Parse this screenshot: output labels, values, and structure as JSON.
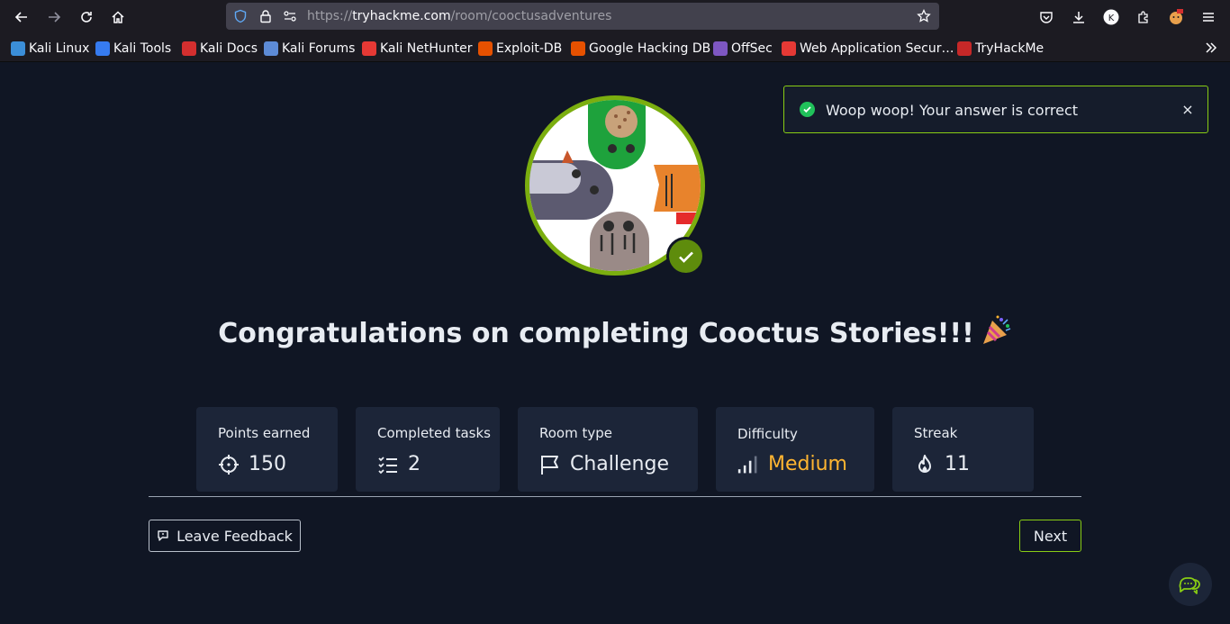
{
  "browser": {
    "url_prefix": "https://",
    "url_host": "tryhackme.com",
    "url_path": "/room/cooctusadventures"
  },
  "bookmarks": [
    {
      "label": "Kali Linux",
      "color": "#3b8ed8"
    },
    {
      "label": "Kali Tools",
      "color": "#367bf0"
    },
    {
      "label": "Kali Docs",
      "color": "#d32f2f"
    },
    {
      "label": "Kali Forums",
      "color": "#5d8bd6"
    },
    {
      "label": "Kali NetHunter",
      "color": "#e53935"
    },
    {
      "label": "Exploit-DB",
      "color": "#e65100"
    },
    {
      "label": "Google Hacking DB",
      "color": "#e65100"
    },
    {
      "label": "OffSec",
      "color": "#7e57c2"
    },
    {
      "label": "Web Application Secur…",
      "color": "#e53935"
    },
    {
      "label": "TryHackMe",
      "color": "#c62828"
    }
  ],
  "toast": {
    "message": "Woop woop! Your answer is correct",
    "close": "×"
  },
  "congrats": {
    "text": "Congratulations on completing Cooctus Stories!!!"
  },
  "stats": {
    "points": {
      "label": "Points earned",
      "value": "150",
      "icon": "crosshair-icon"
    },
    "tasks": {
      "label": "Completed tasks",
      "value": "2",
      "icon": "checklist-icon"
    },
    "room_type": {
      "label": "Room type",
      "value": "Challenge",
      "icon": "flag-icon"
    },
    "difficulty": {
      "label": "Difficulty",
      "value": "Medium",
      "icon": "signal-bars-icon",
      "color": "#ffb531"
    },
    "streak": {
      "label": "Streak",
      "value": "11",
      "icon": "flame-icon"
    }
  },
  "actions": {
    "feedback": "Leave Feedback",
    "next": "Next"
  },
  "colors": {
    "accent": "#88cc14",
    "background": "#101624",
    "card": "#1c2538"
  }
}
